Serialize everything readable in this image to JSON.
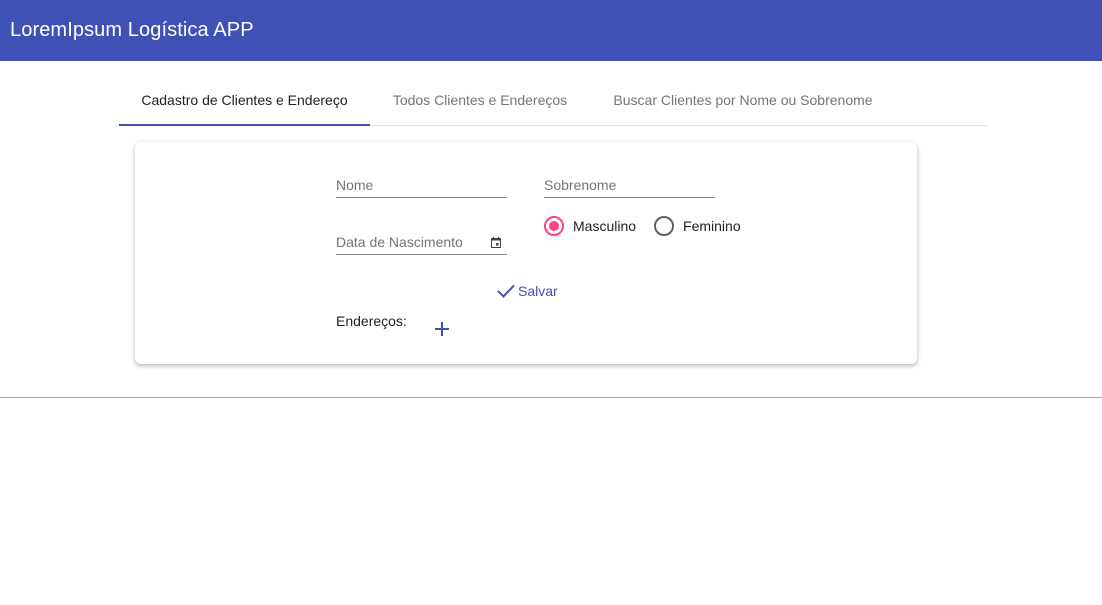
{
  "app": {
    "title": "LoremIpsum Logística APP"
  },
  "tabs": [
    {
      "label": "Cadastro de Clientes e Endereço",
      "active": true
    },
    {
      "label": "Todos Clientes e Endereços",
      "active": false
    },
    {
      "label": "Buscar Clientes por Nome ou Sobrenome",
      "active": false
    }
  ],
  "form": {
    "nome": {
      "placeholder": "Nome",
      "value": ""
    },
    "sobrenome": {
      "placeholder": "Sobrenome",
      "value": ""
    },
    "data_nascimento": {
      "placeholder": "Data de Nascimento",
      "value": ""
    },
    "genero": {
      "options": [
        {
          "label": "Masculino",
          "checked": true
        },
        {
          "label": "Feminino",
          "checked": false
        }
      ]
    },
    "save_label": "Salvar",
    "enderecos_label": "Endereços:"
  },
  "colors": {
    "primary": "#3f51b5",
    "accent": "#ff4081"
  },
  "icons": {
    "calendar": "calendar-icon",
    "check": "check-icon",
    "add": "plus-icon"
  }
}
